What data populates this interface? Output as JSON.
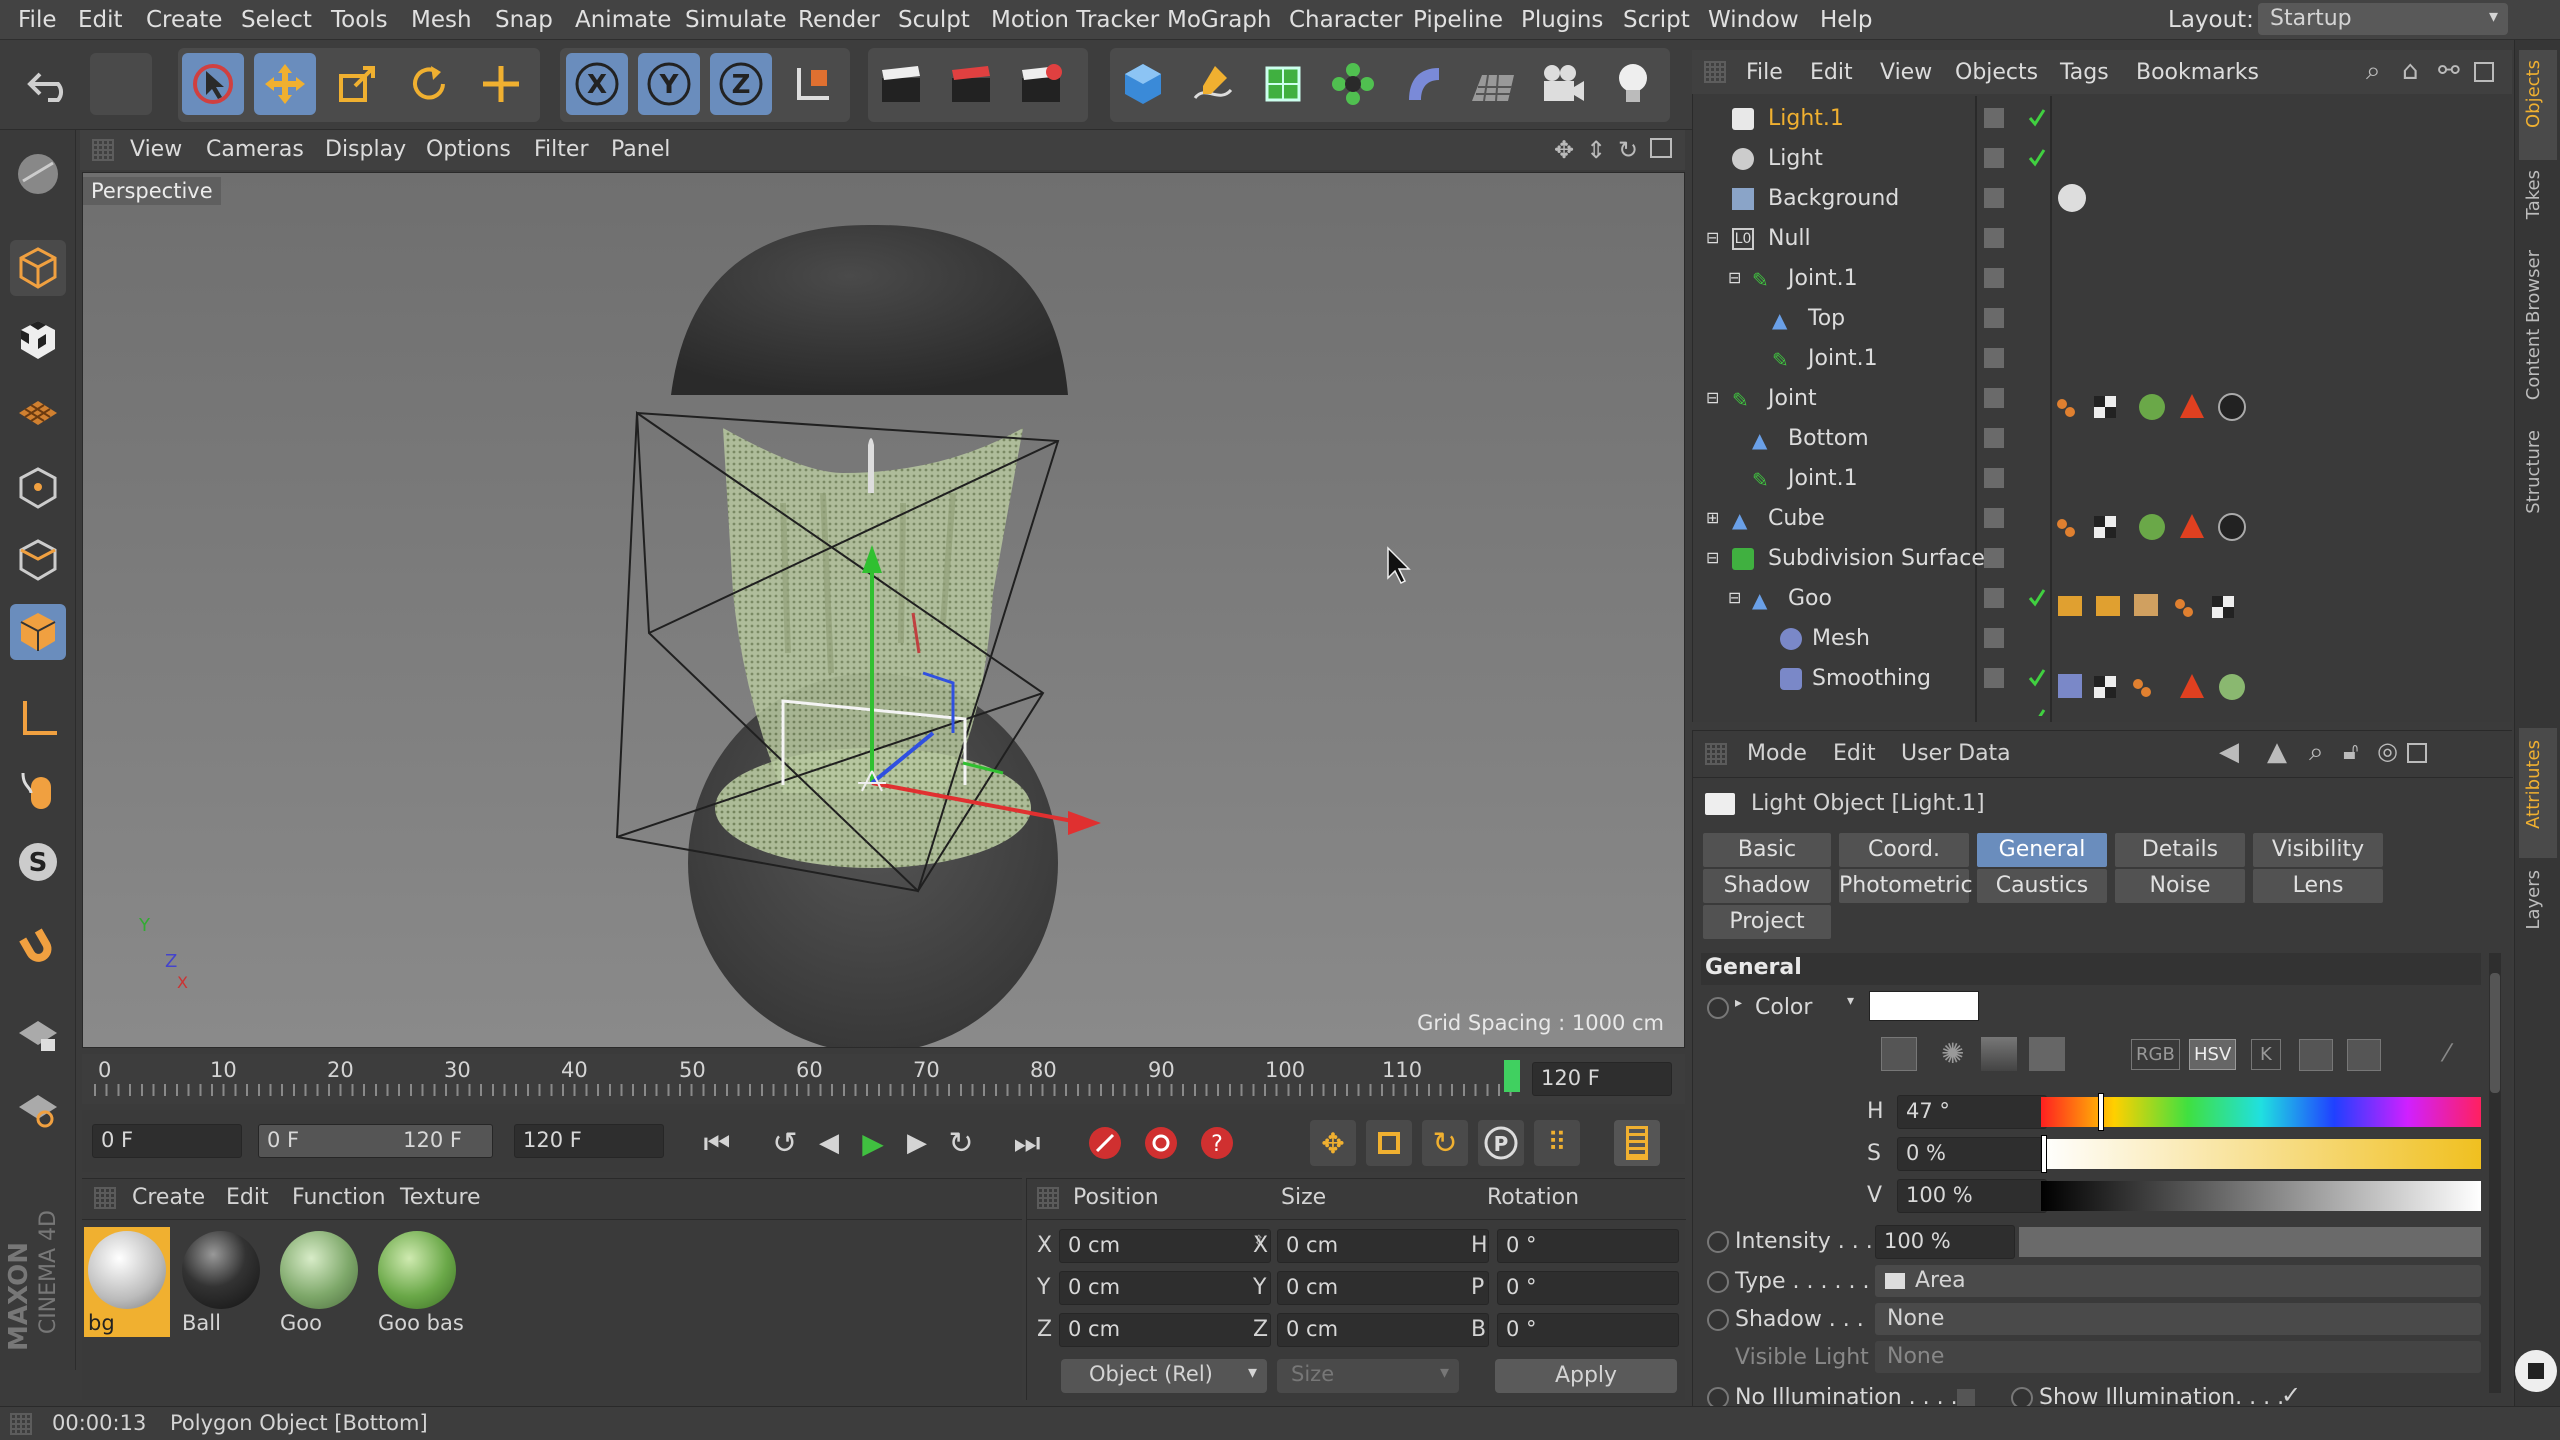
{
  "menu": [
    "File",
    "Edit",
    "Create",
    "Select",
    "Tools",
    "Mesh",
    "Snap",
    "Animate",
    "Simulate",
    "Render",
    "Sculpt",
    "Motion Tracker",
    "MoGraph",
    "Character",
    "Pipeline",
    "Plugins",
    "Script",
    "Window",
    "Help"
  ],
  "layout": {
    "label": "Layout:",
    "value": "Startup"
  },
  "toolbar": {
    "axis_x": "X",
    "axis_y": "Y",
    "axis_z": "Z"
  },
  "viewport": {
    "menu": [
      "View",
      "Cameras",
      "Display",
      "Options",
      "Filter",
      "Panel"
    ],
    "name": "Perspective",
    "grid_spacing": "Grid Spacing : 1000 cm",
    "axis_y": "Y",
    "axis_z": "Z",
    "axis_x": "X"
  },
  "timeline": {
    "ticks": [
      "0",
      "10",
      "20",
      "30",
      "40",
      "50",
      "60",
      "70",
      "80",
      "90",
      "100",
      "110"
    ],
    "end_label": "120 F"
  },
  "transport": {
    "current": "0 F",
    "range_start": "0 F",
    "range_end": "120 F",
    "max": "120 F"
  },
  "materials": {
    "menu": [
      "Create",
      "Edit",
      "Function",
      "Texture"
    ],
    "items": [
      {
        "name": "bg"
      },
      {
        "name": "Ball"
      },
      {
        "name": "Goo"
      },
      {
        "name": "Goo bas"
      }
    ]
  },
  "coords": {
    "headers": [
      "Position",
      "Size",
      "Rotation"
    ],
    "rows": [
      {
        "axis": "X",
        "pos": "0 cm",
        "saxis": "X",
        "size": "0 cm",
        "raxis": "H",
        "rot": "0 °"
      },
      {
        "axis": "Y",
        "pos": "0 cm",
        "saxis": "Y",
        "size": "0 cm",
        "raxis": "P",
        "rot": "0 °"
      },
      {
        "axis": "Z",
        "pos": "0 cm",
        "saxis": "Z",
        "size": "0 cm",
        "raxis": "B",
        "rot": "0 °"
      }
    ],
    "mode": "Object (Rel)",
    "size_mode": "Size",
    "apply": "Apply"
  },
  "status": {
    "time": "00:00:13",
    "text": "Polygon Object [Bottom]"
  },
  "objects": {
    "menu": [
      "File",
      "Edit",
      "View",
      "Objects",
      "Tags",
      "Bookmarks"
    ],
    "rows": [
      {
        "name": "Light.1"
      },
      {
        "name": "Light"
      },
      {
        "name": "Background"
      },
      {
        "name": "Null"
      },
      {
        "name": "Joint.1"
      },
      {
        "name": "Top"
      },
      {
        "name": "Joint.1"
      },
      {
        "name": "Joint"
      },
      {
        "name": "Bottom"
      },
      {
        "name": "Joint.1"
      },
      {
        "name": "Cube"
      },
      {
        "name": "Subdivision Surface"
      },
      {
        "name": "Goo"
      },
      {
        "name": "Mesh"
      },
      {
        "name": "Smoothing"
      }
    ]
  },
  "attributes": {
    "menu": [
      "Mode",
      "Edit",
      "User Data"
    ],
    "title": "Light Object [Light.1]",
    "tabs": [
      "Basic",
      "Coord.",
      "General",
      "Details",
      "Visibility",
      "Shadow",
      "Photometric",
      "Caustics",
      "Noise",
      "Lens",
      "Project"
    ],
    "section": "General",
    "color_label": "Color",
    "color_value": "#ffffff",
    "h_label": "H",
    "h_value": "47 °",
    "h_level": 0.13,
    "s_label": "S",
    "s_value": "0 %",
    "v_label": "V",
    "v_value": "100 %",
    "mode_rgb": "RGB",
    "mode_hsv": "HSV",
    "mode_k": "K",
    "intensity_label": "Intensity . . .",
    "intensity_value": "100 %",
    "type_label": "Type . . . . . .",
    "type_value": "Area",
    "shadow_label": "Shadow . . .",
    "shadow_value": "None",
    "visible_label": "Visible Light",
    "visible_value": "None",
    "noillum_label": "No Illumination . . . . .",
    "showillum_label": "Show Illumination. . . .",
    "check": "✓"
  },
  "right_tabs": [
    "Objects",
    "Takes",
    "Content Browser",
    "Structure",
    "Attributes",
    "Layers"
  ],
  "brand": {
    "maxon": "MAXON",
    "c4d": "CINEMA 4D"
  },
  "accent": "#6a8dbd",
  "highlight": "#f0b030"
}
